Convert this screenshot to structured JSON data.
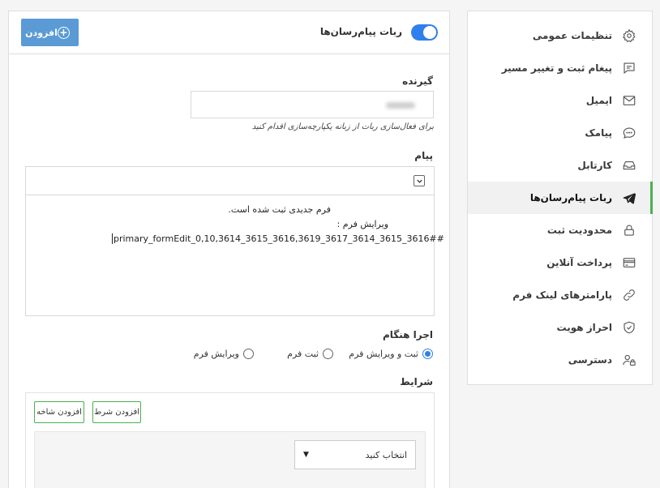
{
  "sidebar": {
    "items": [
      {
        "label": "تنظیمات عمومی",
        "icon": "gear-icon"
      },
      {
        "label": "پیغام ثبت و تغییر مسیر",
        "icon": "message-square-icon"
      },
      {
        "label": "ایمیل",
        "icon": "envelope-icon"
      },
      {
        "label": "پیامک",
        "icon": "chat-bubble-icon"
      },
      {
        "label": "کارتابل",
        "icon": "inbox-icon"
      },
      {
        "label": "ربات پیام‌رسان‌ها",
        "icon": "telegram-plane-icon",
        "active": true
      },
      {
        "label": "محدودیت ثبت",
        "icon": "lock-icon"
      },
      {
        "label": "پرداخت آنلاین",
        "icon": "credit-card-icon"
      },
      {
        "label": "پارامترهای لینک فرم",
        "icon": "link-icon"
      },
      {
        "label": "احراز هویت",
        "icon": "shield-check-icon"
      },
      {
        "label": "دسترسی",
        "icon": "users-lock-icon"
      }
    ],
    "active_color": "#4caf50"
  },
  "header": {
    "add_label": "افزودن",
    "toggle_label": "ربات پیام‌رسان‌ها",
    "toggle_on": true,
    "accent": "#2f80ed"
  },
  "recipient": {
    "title": "گیرنده",
    "hint": "برای فعال‌سازی ربات از زبانه یکپارچه‌سازی اقدام کنید"
  },
  "message": {
    "title": "پیام",
    "lines": [
      "فرم جدیدی ثبت شده است.",
      "ویرایش فرم :",
      "primary_formEdit_0,10,3614_3615_3616,3619_3617_3614_3615_3616##"
    ]
  },
  "run_on": {
    "title": "اجرا هنگام",
    "options": [
      {
        "label": "ثبت و ویرایش فرم",
        "checked": true
      },
      {
        "label": "ثبت فرم",
        "checked": false
      },
      {
        "label": "ویرایش فرم",
        "checked": false
      }
    ]
  },
  "conditions": {
    "title": "شرایط",
    "add_condition_label": "افزودن شرط",
    "add_branch_label": "افزودن شاخه",
    "select_value": "انتخاب کنید"
  }
}
